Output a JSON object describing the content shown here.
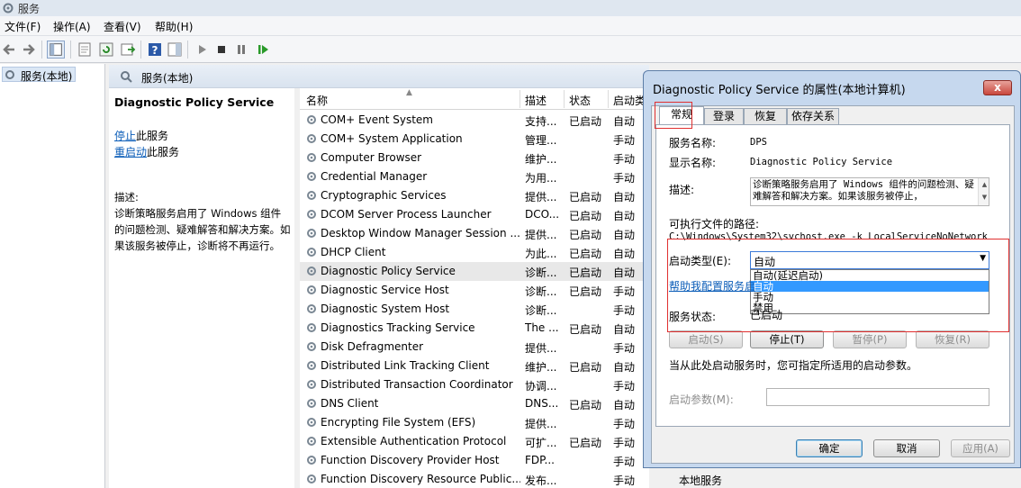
{
  "window": {
    "title": "服务"
  },
  "menu": [
    "文件(F)",
    "操作(A)",
    "查看(V)",
    "帮助(H)"
  ],
  "tree": {
    "root": "服务(本地)"
  },
  "panel": {
    "title": "服务(本地)"
  },
  "details": {
    "service_name": "Diagnostic Policy Service",
    "stop_link": "停止",
    "stop_suffix": "此服务",
    "restart_link": "重启动",
    "restart_suffix": "此服务",
    "desc_label": "描述:",
    "desc_text": "诊断策略服务启用了 Windows 组件的问题检测、疑难解答和解决方案。如果该服务被停止，诊断将不再运行。"
  },
  "list": {
    "columns": [
      "名称",
      "描述",
      "状态",
      "启动类"
    ],
    "rows": [
      {
        "name": "COM+ Event System",
        "desc": "支持...",
        "status": "已启动",
        "startup": "自动"
      },
      {
        "name": "COM+ System Application",
        "desc": "管理...",
        "status": "",
        "startup": "手动"
      },
      {
        "name": "Computer Browser",
        "desc": "维护...",
        "status": "",
        "startup": "手动"
      },
      {
        "name": "Credential Manager",
        "desc": "为用...",
        "status": "",
        "startup": "手动"
      },
      {
        "name": "Cryptographic Services",
        "desc": "提供...",
        "status": "已启动",
        "startup": "自动"
      },
      {
        "name": "DCOM Server Process Launcher",
        "desc": "DCO...",
        "status": "已启动",
        "startup": "自动"
      },
      {
        "name": "Desktop Window Manager Session ...",
        "desc": "提供...",
        "status": "已启动",
        "startup": "自动"
      },
      {
        "name": "DHCP Client",
        "desc": "为此...",
        "status": "已启动",
        "startup": "自动"
      },
      {
        "name": "Diagnostic Policy Service",
        "desc": "诊断...",
        "status": "已启动",
        "startup": "自动"
      },
      {
        "name": "Diagnostic Service Host",
        "desc": "诊断...",
        "status": "已启动",
        "startup": "手动"
      },
      {
        "name": "Diagnostic System Host",
        "desc": "诊断...",
        "status": "",
        "startup": "手动"
      },
      {
        "name": "Diagnostics Tracking Service",
        "desc": "The ...",
        "status": "已启动",
        "startup": "自动"
      },
      {
        "name": "Disk Defragmenter",
        "desc": "提供...",
        "status": "",
        "startup": "手动"
      },
      {
        "name": "Distributed Link Tracking Client",
        "desc": "维护...",
        "status": "已启动",
        "startup": "自动"
      },
      {
        "name": "Distributed Transaction Coordinator",
        "desc": "协调...",
        "status": "",
        "startup": "手动"
      },
      {
        "name": "DNS Client",
        "desc": "DNS...",
        "status": "已启动",
        "startup": "自动"
      },
      {
        "name": "Encrypting File System (EFS)",
        "desc": "提供...",
        "status": "",
        "startup": "手动"
      },
      {
        "name": "Extensible Authentication Protocol",
        "desc": "可扩...",
        "status": "已启动",
        "startup": "手动"
      },
      {
        "name": "Function Discovery Provider Host",
        "desc": "FDP...",
        "status": "",
        "startup": "手动"
      },
      {
        "name": "Function Discovery Resource Public...",
        "desc": "发布...",
        "status": "",
        "startup": "手动"
      }
    ]
  },
  "dialog": {
    "title": "Diagnostic Policy Service 的属性(本地计算机)",
    "close": "x",
    "tabs": [
      "常规",
      "登录",
      "恢复",
      "依存关系"
    ],
    "service_name_label": "服务名称:",
    "service_name_value": "DPS",
    "display_name_label": "显示名称:",
    "display_name_value": "Diagnostic Policy Service",
    "desc_label": "描述:",
    "desc_value": "诊断策略服务启用了 Windows 组件的问题检测、疑难解答和解决方案。如果该服务被停止，",
    "path_label": "可执行文件的路径:",
    "path_value": "C:\\Windows\\System32\\svchost.exe -k LocalServiceNoNetwork",
    "startup_label": "启动类型(E):",
    "startup_value": "自动",
    "startup_options": [
      "自动(延迟启动)",
      "自动",
      "手动",
      "禁用"
    ],
    "help_link": "帮助我配置服务启",
    "status_label": "服务状态:",
    "status_value": "已启动",
    "btn_start": "启动(S)",
    "btn_stop": "停止(T)",
    "btn_pause": "暂停(P)",
    "btn_resume": "恢复(R)",
    "hint": "当从此处启动服务时，您可指定所适用的启动参数。",
    "param_label": "启动参数(M):",
    "ok": "确定",
    "cancel": "取消",
    "apply": "应用(A)"
  },
  "bottom": {
    "fragment": "本地服务"
  }
}
